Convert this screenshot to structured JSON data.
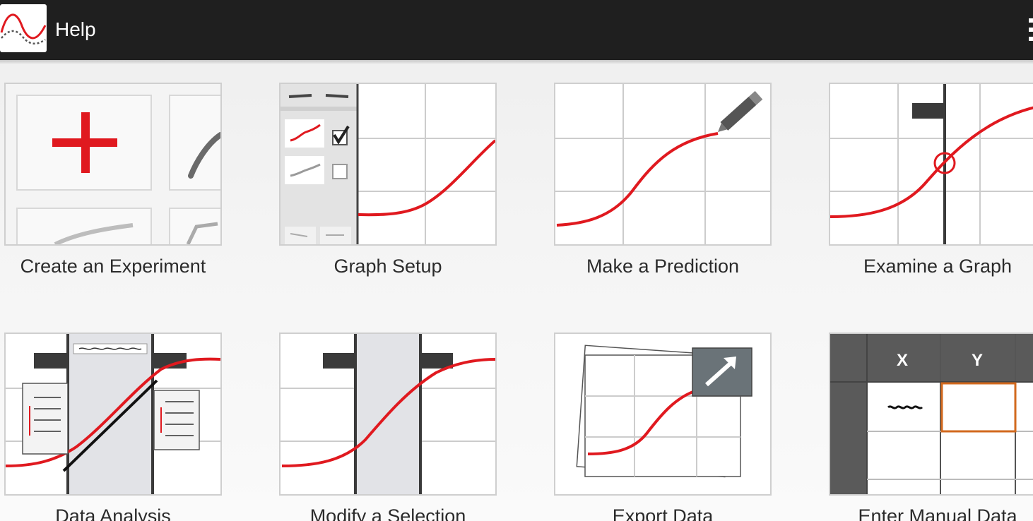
{
  "app": {
    "title": "Help",
    "icon": "graph-app-icon",
    "menu_icon": "overflow-menu-icon"
  },
  "colors": {
    "action_bar": "#1f1f1f",
    "accent_red": "#e0191f",
    "grid": "#cccccc",
    "dark": "#3a3a3a"
  },
  "help_topics": [
    {
      "label": "Create an Experiment",
      "icon": "create-experiment-illustration"
    },
    {
      "label": "Graph Setup",
      "icon": "graph-setup-illustration"
    },
    {
      "label": "Make a Prediction",
      "icon": "make-prediction-illustration"
    },
    {
      "label": "Examine a Graph",
      "icon": "examine-graph-illustration"
    },
    {
      "label": "Data Analysis",
      "icon": "data-analysis-illustration"
    },
    {
      "label": "Modify a Selection",
      "icon": "modify-selection-illustration"
    },
    {
      "label": "Export Data",
      "icon": "export-data-illustration"
    },
    {
      "label": "Enter Manual Data",
      "icon": "manual-data-illustration"
    }
  ],
  "manual_data_table": {
    "col_x": "X",
    "col_y": "Y"
  }
}
